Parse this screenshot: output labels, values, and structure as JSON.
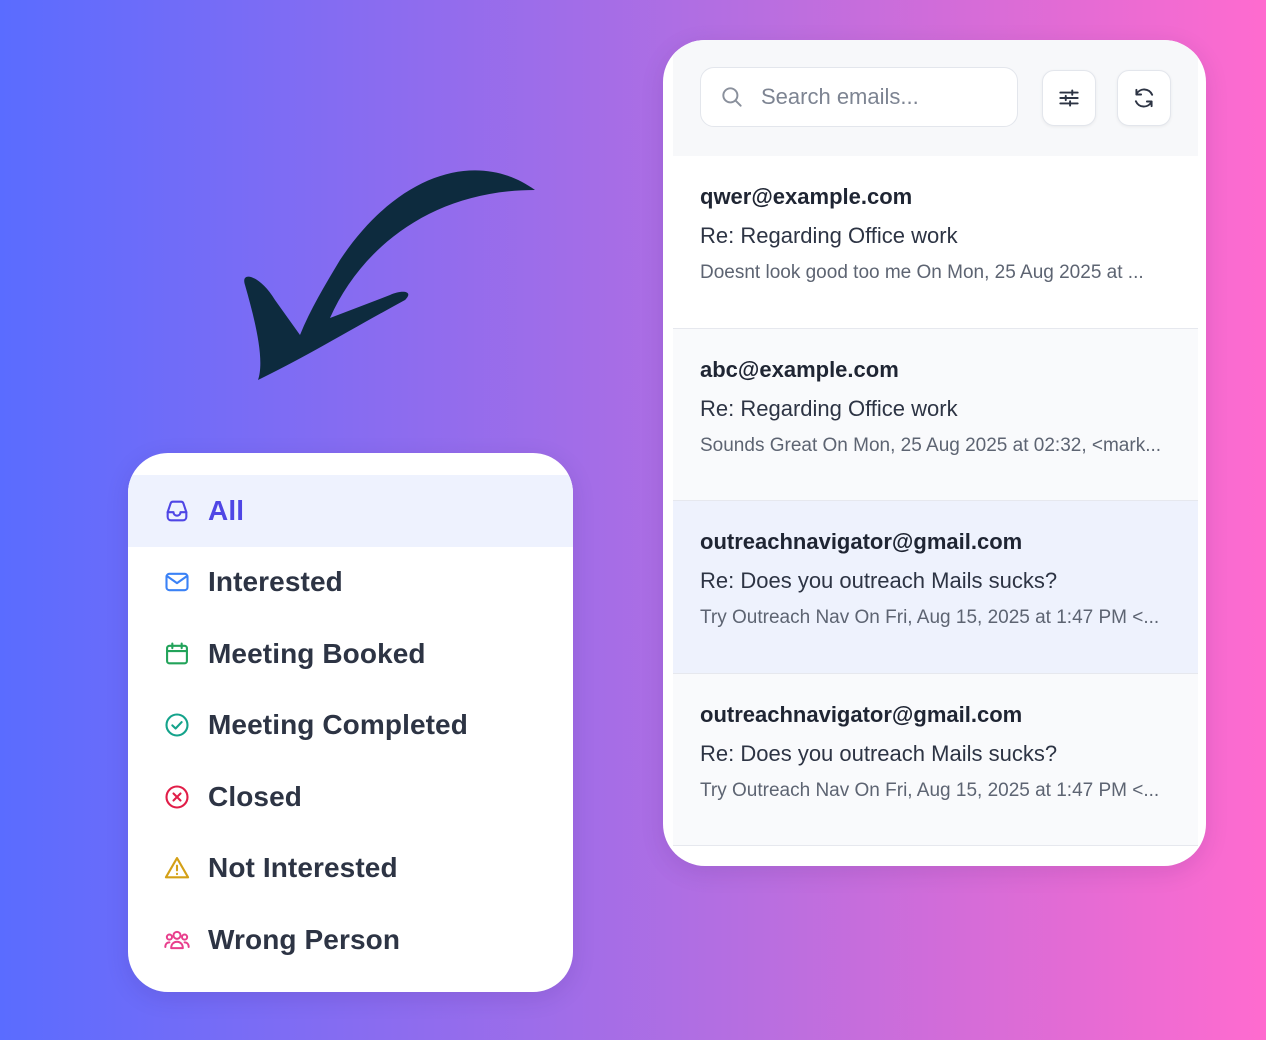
{
  "categories": [
    {
      "label": "All",
      "icon": "inbox-icon",
      "color": "#4f46e5",
      "active": true
    },
    {
      "label": "Interested",
      "icon": "mail-icon",
      "color": "#3b82f6"
    },
    {
      "label": "Meeting Booked",
      "icon": "calendar-icon",
      "color": "#22a35a"
    },
    {
      "label": "Meeting Completed",
      "icon": "check-circle-icon",
      "color": "#14a38b"
    },
    {
      "label": "Closed",
      "icon": "x-circle-icon",
      "color": "#e11d48"
    },
    {
      "label": "Not Interested",
      "icon": "warning-triangle-icon",
      "color": "#d4a017"
    },
    {
      "label": "Wrong Person",
      "icon": "users-icon",
      "color": "#e83e8c"
    }
  ],
  "toolbar": {
    "search_placeholder": "Search emails...",
    "filter_icon": "sliders-icon",
    "refresh_icon": "refresh-icon"
  },
  "emails": [
    {
      "from": "qwer@example.com",
      "subject": "Re: Regarding Office work",
      "preview": "Doesnt look good too me On Mon, 25 Aug 2025 at ..."
    },
    {
      "from": "abc@example.com",
      "subject": "Re: Regarding Office work",
      "preview": "Sounds Great On Mon, 25 Aug 2025 at 02:32, <mark..."
    },
    {
      "from": "outreachnavigator@gmail.com",
      "subject": "Re: Does you outreach Mails sucks?",
      "preview": "Try Outreach Nav On Fri, Aug 15, 2025 at 1:47 PM <...",
      "selected": true
    },
    {
      "from": "outreachnavigator@gmail.com",
      "subject": "Re: Does you outreach Mails sucks?",
      "preview": "Try Outreach Nav On Fri, Aug 15, 2025 at 1:47 PM <..."
    }
  ],
  "colors": {
    "arrow": "#0d2b3e",
    "active_bg": "#eef2fe",
    "selected_bg": "#eef2fd"
  }
}
